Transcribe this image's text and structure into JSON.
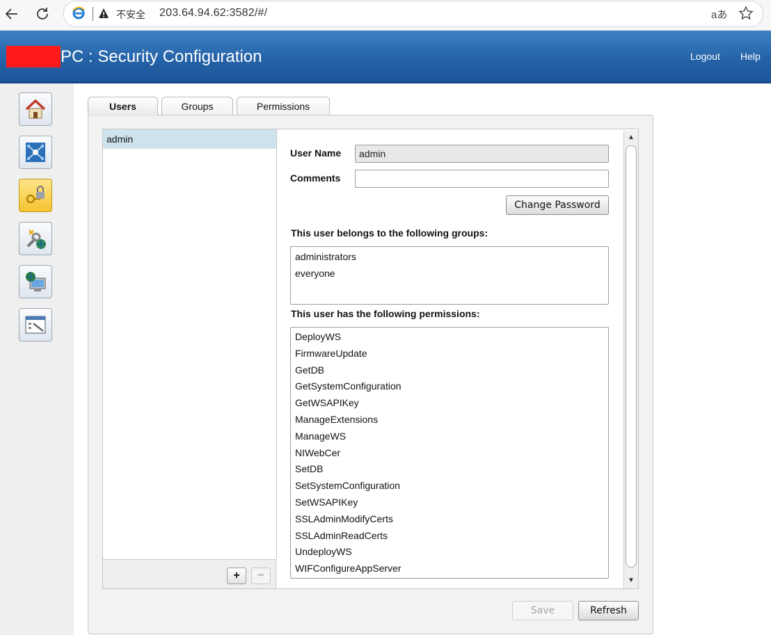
{
  "browser": {
    "insecure_label": "不安全",
    "url": "203.64.94.62:3582/#/",
    "read_aloud_label": "aあ"
  },
  "header": {
    "title": "PC : Security Configuration",
    "logout": "Logout",
    "help": "Help"
  },
  "sidebar": {
    "items": [
      {
        "icon": "home-icon"
      },
      {
        "icon": "network-icon"
      },
      {
        "icon": "security-lock-icon",
        "active": true
      },
      {
        "icon": "tools-globe-icon"
      },
      {
        "icon": "remote-computer-icon"
      },
      {
        "icon": "settings-window-icon"
      }
    ]
  },
  "tabs": [
    {
      "label": "Users",
      "active": true
    },
    {
      "label": "Groups"
    },
    {
      "label": "Permissions"
    }
  ],
  "users": [
    "admin"
  ],
  "detail": {
    "user_name_label": "User Name",
    "user_name_value": "admin",
    "comments_label": "Comments",
    "comments_value": "",
    "change_password": "Change Password",
    "groups_heading": "This user belongs to the following groups:",
    "groups": [
      "administrators",
      "everyone"
    ],
    "permissions_heading": "This user has the following permissions:",
    "permissions": [
      "DeployWS",
      "FirmwareUpdate",
      "GetDB",
      "GetSystemConfiguration",
      "GetWSAPIKey",
      "ManageExtensions",
      "ManageWS",
      "NIWebCer",
      "SetDB",
      "SetSystemConfiguration",
      "SetWSAPIKey",
      "SSLAdminModifyCerts",
      "SSLAdminReadCerts",
      "UndeployWS",
      "WIFConfigureAppServer"
    ]
  },
  "list_controls": {
    "add": "+",
    "remove": "−"
  },
  "footer": {
    "save": "Save",
    "refresh": "Refresh"
  },
  "colors": {
    "header_blue": "#2563a8",
    "selected_row": "#cfe3ee",
    "redaction": "#ff1a1a"
  }
}
